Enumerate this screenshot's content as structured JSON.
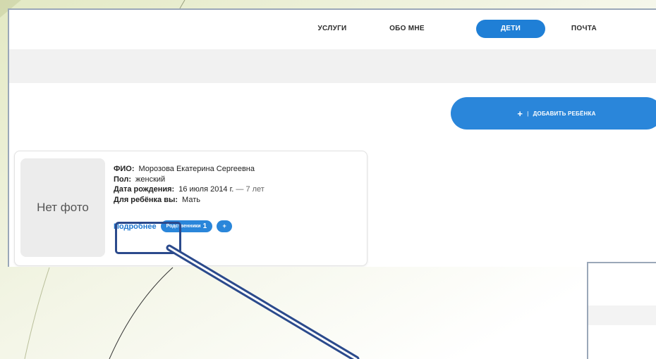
{
  "nav": {
    "items": [
      {
        "label": "УСЛУГИ"
      },
      {
        "label": "ОБО МНЕ"
      },
      {
        "label": "ДЕТИ"
      },
      {
        "label": "ПОЧТА"
      }
    ],
    "active_index": 2
  },
  "add_child_button": {
    "plus": "+",
    "separator": "|",
    "label": "ДОБАВИТЬ РЕБЁНКА"
  },
  "child_card": {
    "photo_placeholder": "Нет фото",
    "fio_label": "ФИО:",
    "fio_value": "Морозова Екатерина Сергеевна",
    "gender_label": "Пол:",
    "gender_value": "женский",
    "birth_label": "Дата рождения:",
    "birth_value": "16 июля 2014 г.",
    "age_text": "— 7 лет",
    "relation_label": "Для ребёнка вы:",
    "relation_value": "Мать",
    "details_link": "Подробнее",
    "relatives_label": "Родственники",
    "relatives_count": "1",
    "add_relative": "+"
  },
  "colors": {
    "accent": "#1f7fd6",
    "highlight": "#2b4a8c",
    "background": "#eef2d8"
  }
}
